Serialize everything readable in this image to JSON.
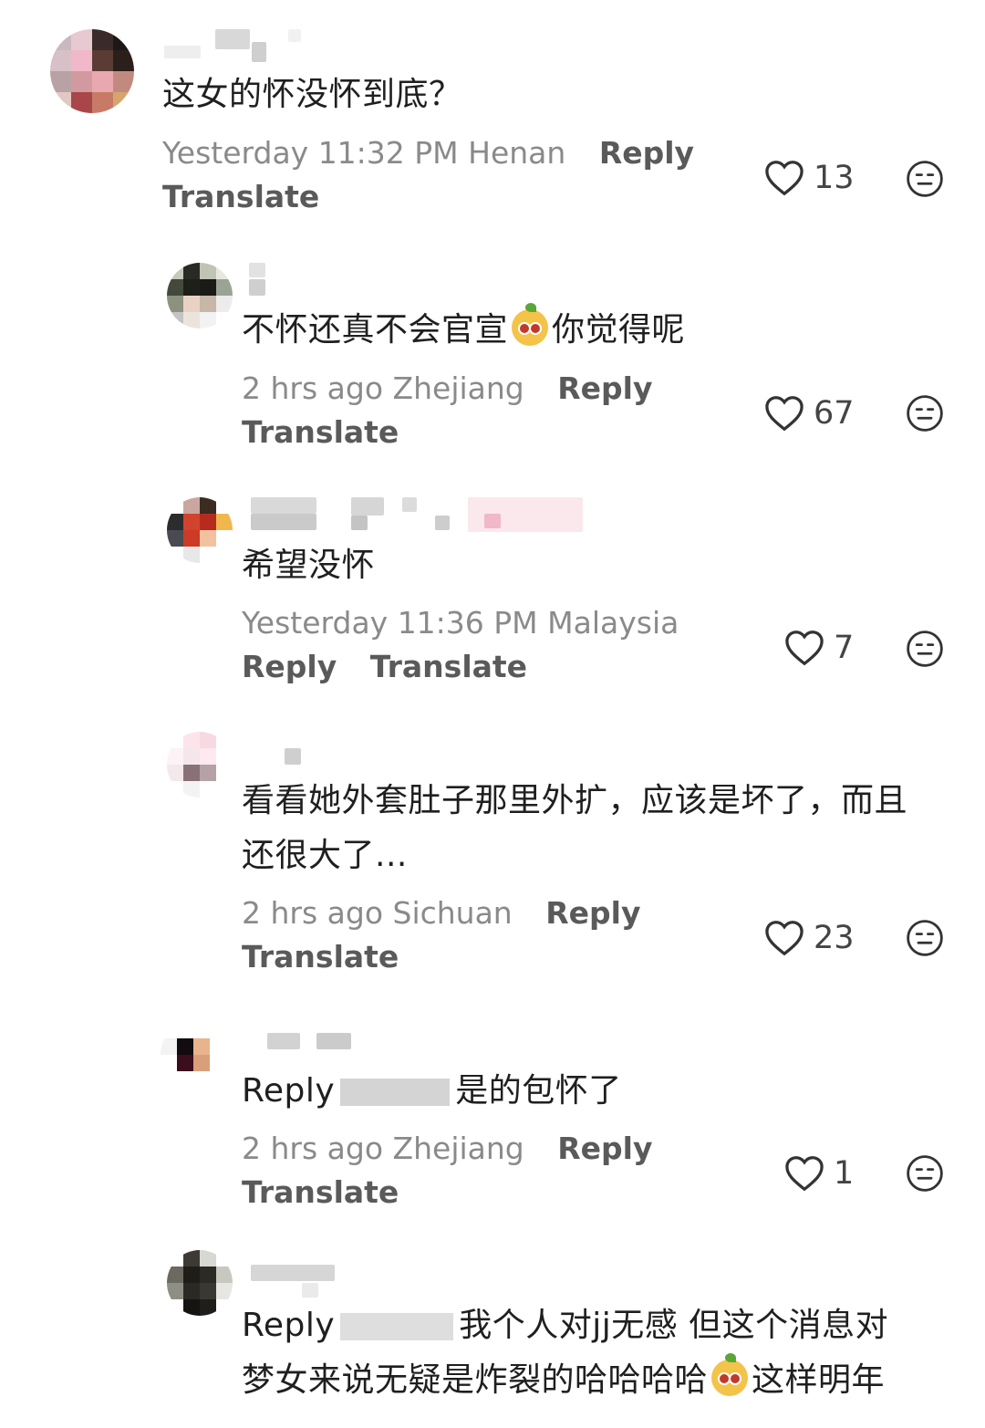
{
  "comments": [
    {
      "text": "这女的怀没怀到底？",
      "time": "Yesterday 11:32 PM Henan",
      "reply": "Reply",
      "translate": "Translate",
      "likes": "13"
    },
    {
      "text_before": "不怀还真不会官宣",
      "text_after": "你觉得呢",
      "emoji": "face-emoji-icon",
      "time": "2 hrs ago Zhejiang",
      "reply": "Reply",
      "translate": "Translate",
      "likes": "67"
    },
    {
      "text": "希望没怀",
      "time": "Yesterday 11:36 PM Malaysia",
      "reply": "Reply",
      "translate": "Translate",
      "likes": "7"
    },
    {
      "text_line1": "看看她外套肚子那里外扩，应该是坏了，而且",
      "text_line2": "还很大了...",
      "time": "2 hrs ago Sichuan",
      "reply": "Reply",
      "translate": "Translate",
      "likes": "23"
    },
    {
      "prefix": "Reply",
      "text": "是的包怀了",
      "time": "2 hrs ago Zhejiang",
      "reply": "Reply",
      "translate": "Translate",
      "likes": "1"
    },
    {
      "prefix": "Reply",
      "text_line1": "我个人对jj无感 但这个消息对",
      "text_line2_before": "梦女来说无疑是炸裂的哈哈哈哈",
      "text_line2_after": "这样明年"
    }
  ],
  "colors": {
    "text": "#1f1f1f",
    "meta": "#8a8a8a",
    "action": "#5a5a5a"
  }
}
